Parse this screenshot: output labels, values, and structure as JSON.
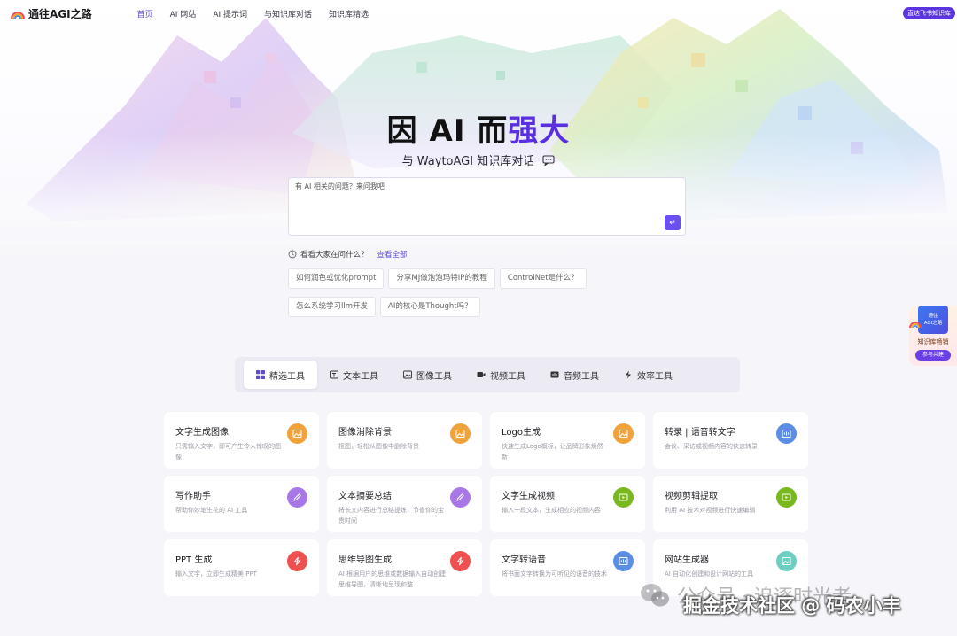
{
  "nav": {
    "logo": "通往AGI之路",
    "links": [
      "首页",
      "AI 网站",
      "AI 提示词",
      "与知识库对话",
      "知识库精选"
    ],
    "active_index": 0,
    "feishu_button": "直达飞书知识库"
  },
  "hero": {
    "title_plain": "因 AI 而",
    "title_accent": "强大",
    "subtitle": "与 WaytoAGI 知识库对话"
  },
  "ask": {
    "placeholder": "有 AI 相关的问题？来问我吧",
    "send_icon": "enter-icon"
  },
  "popular": {
    "label": "看看大家在问什么？",
    "view_all": "查看全部",
    "rows": [
      [
        "如何润色或优化prompt",
        "分享MJ做泡泡玛特IP的教程",
        "ControlNet是什么？"
      ],
      [
        "怎么系统学习llm开发",
        "AI的核心是Thought吗？"
      ]
    ]
  },
  "tabs": [
    {
      "label": "精选工具",
      "icon": "grid-icon"
    },
    {
      "label": "文本工具",
      "icon": "text-icon"
    },
    {
      "label": "图像工具",
      "icon": "image-icon"
    },
    {
      "label": "视频工具",
      "icon": "video-icon"
    },
    {
      "label": "音频工具",
      "icon": "audio-icon"
    },
    {
      "label": "效率工具",
      "icon": "bolt-icon"
    }
  ],
  "active_tab": 0,
  "tools": [
    {
      "title": "文字生成图像",
      "desc": "只需输入文字，即可产生令人惊叹的图像",
      "icon": "image-icon",
      "color": "#f0a23c"
    },
    {
      "title": "图像消除背景",
      "desc": "抠图，轻松从图像中删除背景",
      "icon": "image-icon",
      "color": "#f0a23c"
    },
    {
      "title": "Logo生成",
      "desc": "快速生成Logo概标，让品牌形象焕然一新",
      "icon": "image-icon",
      "color": "#f0a23c"
    },
    {
      "title": "转录 | 语音转文字",
      "desc": "会议、采访或视频内容的快速转录",
      "icon": "audio-icon",
      "color": "#5b8fe6"
    },
    {
      "title": "写作助手",
      "desc": "帮助你妙笔生花的 AI 工具",
      "icon": "pen-icon",
      "color": "#a978e8"
    },
    {
      "title": "文本摘要总结",
      "desc": "将长文内容进行总结提炼，节省你的宝贵时间",
      "icon": "pen-icon",
      "color": "#a978e8"
    },
    {
      "title": "文字生成视频",
      "desc": "输入一段文本，生成相应的视频内容",
      "icon": "video-icon",
      "color": "#79b81f"
    },
    {
      "title": "视频剪辑提取",
      "desc": "利用 AI 技术对视频进行快速编辑",
      "icon": "video-icon",
      "color": "#79b81f"
    },
    {
      "title": "PPT 生成",
      "desc": "输入文字，立即生成精美 PPT",
      "icon": "bolt-icon",
      "color": "#ef5050"
    },
    {
      "title": "思维导图生成",
      "desc": "AI 根据用户的思维或数据输入自动创建思维导图，清晰地呈现和整...",
      "icon": "bolt-icon",
      "color": "#ef5050"
    },
    {
      "title": "文字转语音",
      "desc": "将书面文字转换为可听见的语音的技术",
      "icon": "audio-icon",
      "color": "#5b8fe6"
    },
    {
      "title": "网站生成器",
      "desc": "AI 自动化创建和设计网站的工具",
      "icon": "image-icon",
      "color": "#6ccfc2"
    }
  ],
  "float_widget": {
    "book_text_1": "通往",
    "book_text_2": "AGI之路",
    "label": "知识库畅销",
    "button": "参与共建"
  },
  "watermark": {
    "line1": "公众号 · 追逐时光者",
    "line2": "掘金技术社区 @ 码农小丰"
  }
}
